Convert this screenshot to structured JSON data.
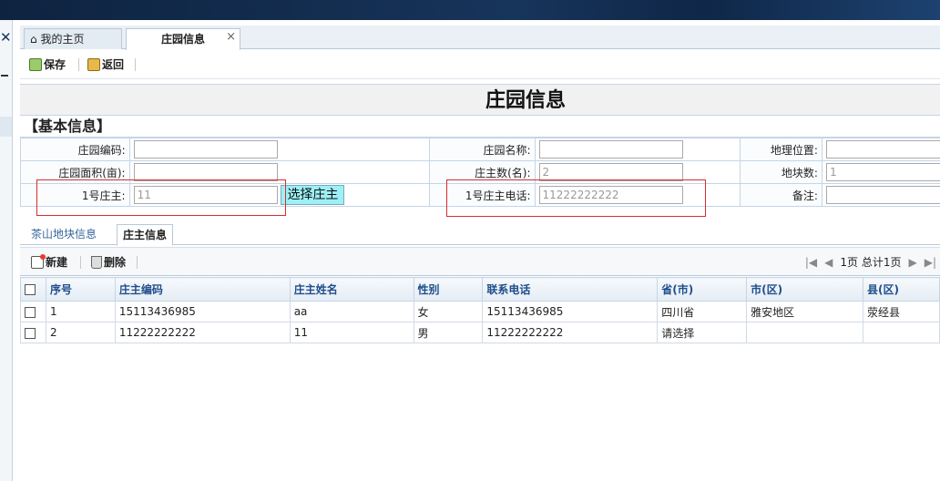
{
  "tabs": [
    {
      "label": "我的主页"
    },
    {
      "label": "庄园信息",
      "close": "×"
    }
  ],
  "toolbar": {
    "save": "保存",
    "back": "返回"
  },
  "form": {
    "title": "庄园信息",
    "section": "【基本信息】",
    "labels": {
      "code": "庄园编码:",
      "name": "庄园名称:",
      "location": "地理位置:",
      "area": "庄园面积(亩):",
      "owner_count": "庄主数(名):",
      "plot_count": "地块数:",
      "owner1": "1号庄主:",
      "owner1_phone": "1号庄主电话:",
      "remark": "备注:"
    },
    "values": {
      "code": "",
      "name": "",
      "location": "",
      "area": "",
      "owner_count": "2",
      "plot_count": "1",
      "owner1": "11",
      "owner1_phone": "11222222222",
      "remark": ""
    },
    "pick_owner": "选择庄主"
  },
  "subtabs": [
    {
      "label": "茶山地块信息"
    },
    {
      "label": "庄主信息"
    }
  ],
  "grid": {
    "new": "新建",
    "delete": "删除",
    "page_info": "1页 总计1页",
    "columns": [
      "序号",
      "庄主编码",
      "庄主姓名",
      "性别",
      "联系电话",
      "省(市)",
      "市(区)",
      "县(区)"
    ],
    "rows": [
      [
        "1",
        "15113436985",
        "aa",
        "女",
        "15113436985",
        "四川省",
        "雅安地区",
        "荥经县"
      ],
      [
        "2",
        "11222222222",
        "11",
        "男",
        "11222222222",
        "请选择",
        "",
        ""
      ]
    ]
  }
}
